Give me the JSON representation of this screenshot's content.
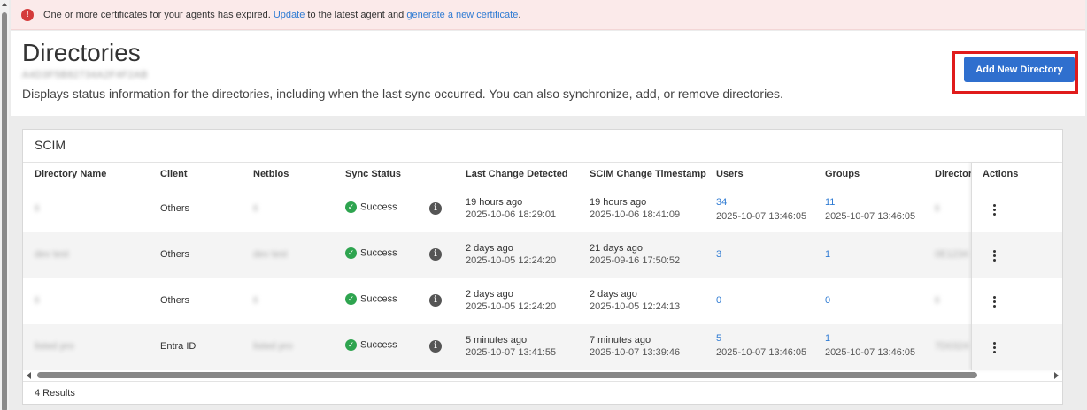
{
  "alert": {
    "icon": "error-icon",
    "text_before": "One or more certificates for your agents has expired.",
    "link_update": "Update",
    "text_middle": "to the latest agent and",
    "link_generate": "generate a new certificate",
    "text_after": "."
  },
  "header": {
    "title": "Directories",
    "subtitle_id": "A4D3F5B82734A2F4F2AB",
    "description": "Displays status information for the directories, including when the last sync occurred. You can also synchronize, add, or remove directories.",
    "add_button": "Add New Directory"
  },
  "colors": {
    "accent": "#2f6fce",
    "link": "#2f7bd3",
    "success": "#2ea44f",
    "error": "#d43a3a",
    "highlight": "#e01b1b"
  },
  "table": {
    "section_title": "SCIM",
    "columns": {
      "name": "Directory Name",
      "client": "Client",
      "netbios": "Netbios",
      "sync_status": "Sync Status",
      "last_change": "Last Change Detected",
      "scim_ts": "SCIM Change Timestamp",
      "users": "Users",
      "groups": "Groups",
      "directory": "Directory",
      "actions": "Actions"
    },
    "rows": [
      {
        "name": "ti",
        "client": "Others",
        "netbios": "ti",
        "status": "Success",
        "last_rel": "19 hours ago",
        "last_abs": "2025-10-06 18:29:01",
        "scim_rel": "19 hours ago",
        "scim_abs": "2025-10-06 18:41:09",
        "users": "34",
        "users_ts": "2025-10-07 13:46:05",
        "groups": "11",
        "groups_ts": "2025-10-07 13:46:05",
        "dir": "ti"
      },
      {
        "name": "dev test",
        "client": "Others",
        "netbios": "dev test",
        "status": "Success",
        "last_rel": "2 days ago",
        "last_abs": "2025-10-05 12:24:20",
        "scim_rel": "21 days ago",
        "scim_abs": "2025-09-16 17:50:52",
        "users": "3",
        "users_ts": "",
        "groups": "1",
        "groups_ts": "",
        "dir": "0E1234"
      },
      {
        "name": "ti",
        "client": "Others",
        "netbios": "ti",
        "status": "Success",
        "last_rel": "2 days ago",
        "last_abs": "2025-10-05 12:24:20",
        "scim_rel": "2 days ago",
        "scim_abs": "2025-10-05 12:24:13",
        "users": "0",
        "users_ts": "",
        "groups": "0",
        "groups_ts": "",
        "dir": "ti"
      },
      {
        "name": "listed pro",
        "client": "Entra ID",
        "netbios": "listed pro",
        "status": "Success",
        "last_rel": "5 minutes ago",
        "last_abs": "2025-10-07 13:41:55",
        "scim_rel": "7 minutes ago",
        "scim_abs": "2025-10-07 13:39:46",
        "users": "5",
        "users_ts": "2025-10-07 13:46:05",
        "groups": "1",
        "groups_ts": "2025-10-07 13:46:05",
        "dir": "7D0324"
      }
    ],
    "results": "4 Results"
  }
}
